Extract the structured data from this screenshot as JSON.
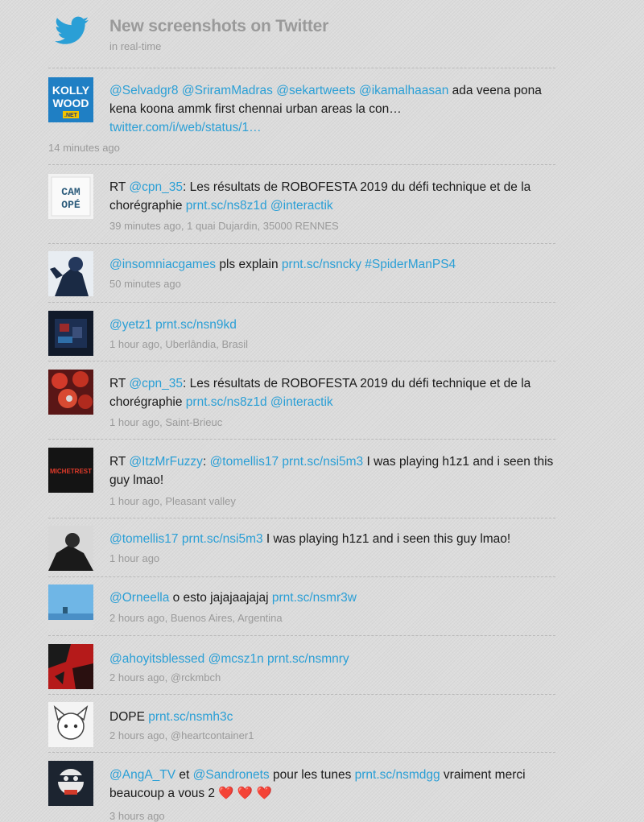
{
  "header": {
    "title": "New screenshots on Twitter",
    "subtitle": "in real-time",
    "icon": "twitter-bird-icon",
    "accent": "#2a9fd6"
  },
  "tweets": [
    {
      "avatar_text": [
        "KOLLY",
        "WOOD",
        ".NET"
      ],
      "parts": [
        {
          "t": "@Selvadgr8",
          "link": true
        },
        {
          "t": " "
        },
        {
          "t": "@SriramMadras",
          "link": true
        },
        {
          "t": " "
        },
        {
          "t": "@sekartweets",
          "link": true
        },
        {
          "t": " "
        },
        {
          "t": "@ikamalhaasan",
          "link": true
        },
        {
          "t": " ada veena pona kena koona ammk first chennai urban areas la con… "
        },
        {
          "t": "twitter.com/i/web/status/1…",
          "link": true
        }
      ],
      "meta": "14 minutes ago"
    },
    {
      "avatar_text": [
        "CAM",
        "OPÉ"
      ],
      "parts": [
        {
          "t": "RT "
        },
        {
          "t": "@cpn_35",
          "link": true
        },
        {
          "t": ": Les résultats de ROBOFESTA 2019 du défi technique et de la chorégraphie "
        },
        {
          "t": "prnt.sc/ns8z1d",
          "link": true
        },
        {
          "t": " "
        },
        {
          "t": "@interactik",
          "link": true
        }
      ],
      "meta": "39 minutes ago, 1 quai Dujardin, 35000 RENNES"
    },
    {
      "parts": [
        {
          "t": "@insomniacgames",
          "link": true
        },
        {
          "t": " pls explain "
        },
        {
          "t": "prnt.sc/nsncky",
          "link": true
        },
        {
          "t": " "
        },
        {
          "t": "#SpiderManPS4",
          "link": true
        }
      ],
      "meta": "50 minutes ago"
    },
    {
      "parts": [
        {
          "t": "@yetz1",
          "link": true
        },
        {
          "t": " "
        },
        {
          "t": "prnt.sc/nsn9kd",
          "link": true
        }
      ],
      "meta": "1 hour ago, Uberlândia, Brasil"
    },
    {
      "parts": [
        {
          "t": "RT "
        },
        {
          "t": "@cpn_35",
          "link": true
        },
        {
          "t": ": Les résultats de ROBOFESTA 2019 du défi technique et de la chorégraphie "
        },
        {
          "t": "prnt.sc/ns8z1d",
          "link": true
        },
        {
          "t": " "
        },
        {
          "t": "@interactik",
          "link": true
        }
      ],
      "meta": "1 hour ago, Saint-Brieuc"
    },
    {
      "avatar_text": [
        "MICHETREST"
      ],
      "parts": [
        {
          "t": "RT "
        },
        {
          "t": "@ItzMrFuzzy",
          "link": true
        },
        {
          "t": ": "
        },
        {
          "t": "@tomellis17",
          "link": true
        },
        {
          "t": " "
        },
        {
          "t": "prnt.sc/nsi5m3",
          "link": true
        },
        {
          "t": " I was playing h1z1 and i seen this guy lmao!"
        }
      ],
      "meta": "1 hour ago, Pleasant valley"
    },
    {
      "parts": [
        {
          "t": "@tomellis17",
          "link": true
        },
        {
          "t": " "
        },
        {
          "t": "prnt.sc/nsi5m3",
          "link": true
        },
        {
          "t": " I was playing h1z1 and i seen this guy lmao!"
        }
      ],
      "meta": "1 hour ago"
    },
    {
      "parts": [
        {
          "t": "@Orneella",
          "link": true
        },
        {
          "t": " o esto jajajaajajaj "
        },
        {
          "t": "prnt.sc/nsmr3w",
          "link": true
        }
      ],
      "meta": "2 hours ago, Buenos Aires, Argentina"
    },
    {
      "parts": [
        {
          "t": "@ahoyitsblessed",
          "link": true
        },
        {
          "t": " "
        },
        {
          "t": "@mcsz1n",
          "link": true
        },
        {
          "t": " "
        },
        {
          "t": "prnt.sc/nsmnry",
          "link": true
        }
      ],
      "meta": "2 hours ago, @rckmbch"
    },
    {
      "parts": [
        {
          "t": "DOPE "
        },
        {
          "t": "prnt.sc/nsmh3c",
          "link": true
        }
      ],
      "meta": "2 hours ago, @heartcontainer1"
    },
    {
      "parts": [
        {
          "t": "@AngA_TV",
          "link": true
        },
        {
          "t": " et "
        },
        {
          "t": "@Sandronets",
          "link": true
        },
        {
          "t": " pour les tunes "
        },
        {
          "t": "prnt.sc/nsmdgg",
          "link": true
        },
        {
          "t": " vraiment merci beaucoup a vous 2 "
        },
        {
          "t": "❤️ ❤️ ❤️",
          "heart": true
        }
      ],
      "meta": "3 hours ago"
    }
  ]
}
